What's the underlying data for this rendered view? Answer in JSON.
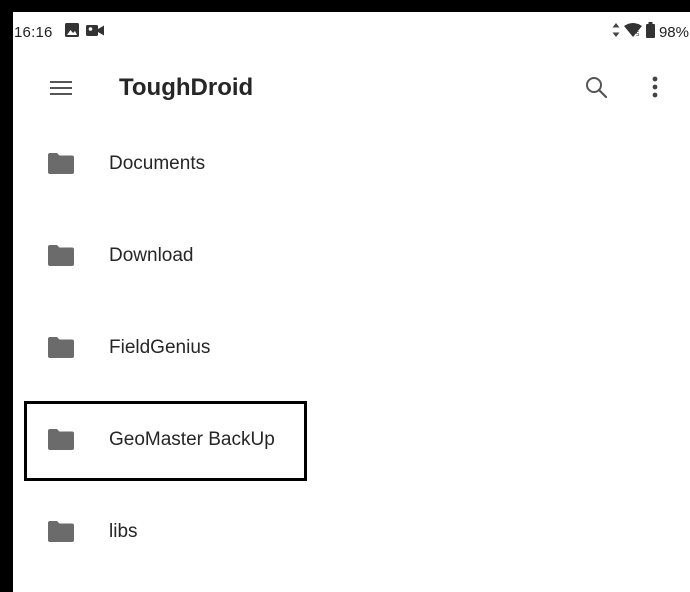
{
  "status_bar": {
    "time": "16:16",
    "battery": "98%",
    "icons": [
      "image-icon",
      "video-camera-icon",
      "data-arrows-icon",
      "wifi-icon",
      "battery-icon"
    ]
  },
  "app_bar": {
    "title": "ToughDroid",
    "icons": [
      "hamburger-menu-icon",
      "search-icon",
      "more-vert-icon"
    ]
  },
  "folders": [
    {
      "label": "Documents"
    },
    {
      "label": "Download"
    },
    {
      "label": "FieldGenius"
    },
    {
      "label": "GeoMaster BackUp"
    },
    {
      "label": "libs"
    }
  ],
  "colors": {
    "icon_gray": "#6b6b6b",
    "text": "#262626",
    "highlight_border": "#000000"
  }
}
